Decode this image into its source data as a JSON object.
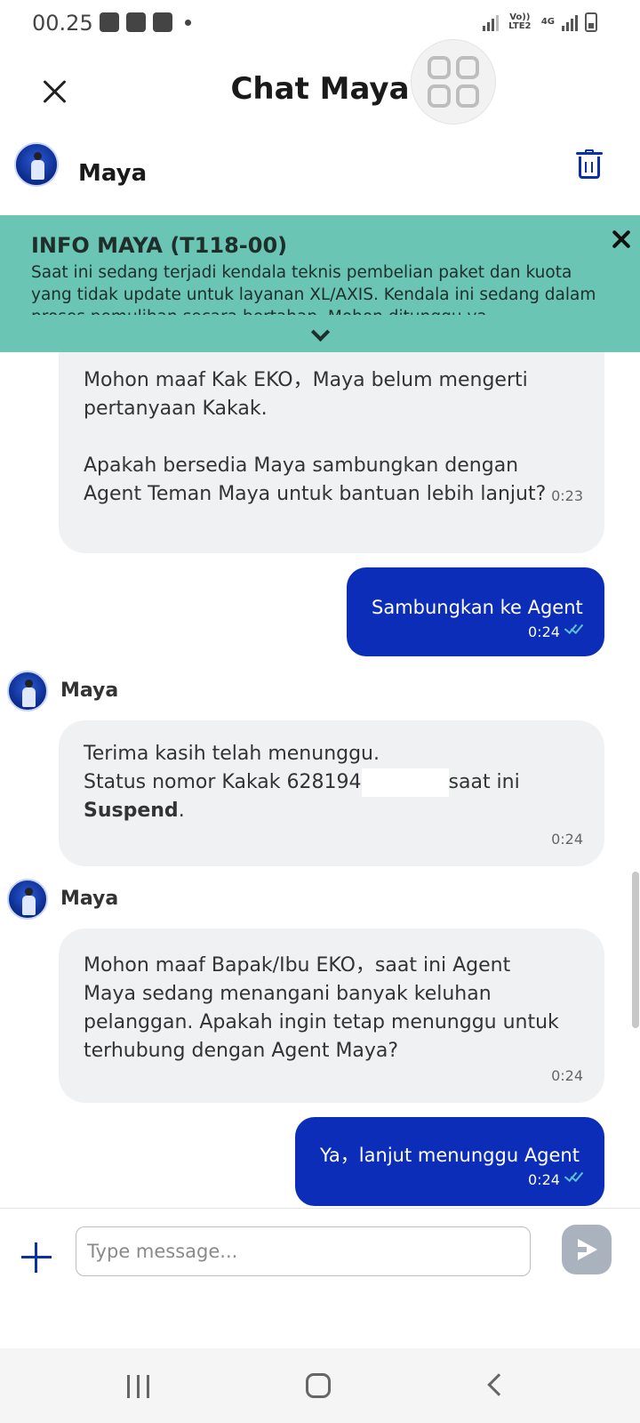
{
  "status_bar": {
    "time": "00.25",
    "network_labels": [
      "Vo)) LTE2",
      "4G"
    ]
  },
  "header": {
    "title": "Chat Maya"
  },
  "contact": {
    "name": "Maya"
  },
  "info_banner": {
    "title": "INFO MAYA (T118-00)",
    "text": "Saat ini sedang terjadi kendala teknis pembelian paket dan kuota yang tidak update untuk layanan XL/AXIS. Kendala ini sedang dalam proses pemulihan secara bertahap. Mohon ditunggu ya"
  },
  "messages": [
    {
      "from": "bot",
      "text": "Mohon maaf Kak EKO，Maya belum mengerti pertanyaan Kakak.\n\nApakah bersedia Maya sambungkan dengan Agent Teman Maya untuk bantuan lebih lanjut?",
      "time": "0:23"
    },
    {
      "from": "user",
      "text": "Sambungkan ke Agent",
      "time": "0:24"
    },
    {
      "from": "bot",
      "sender": "Maya",
      "line1": "Terima kasih telah menunggu.",
      "line2_prefix": "Status nomor Kakak 628194",
      "line2_suffix": "saat ini",
      "bold": "Suspend",
      "after_bold": ".",
      "time": "0:24"
    },
    {
      "from": "bot",
      "sender": "Maya",
      "text": "Mohon maaf Bapak/Ibu EKO，saat ini Agent Maya sedang menangani banyak keluhan pelanggan. Apakah ingin tetap menunggu untuk terhubung dengan Agent Maya?",
      "time": "0:24"
    },
    {
      "from": "user",
      "text": "Ya，lanjut menunggu Agent",
      "time": "0:24"
    }
  ],
  "composer": {
    "placeholder": "Type message..."
  },
  "colors": {
    "banner": "#6ac5b4",
    "user_bubble": "#0b2db8",
    "bot_bubble": "#eff1f3",
    "accent": "#0b2fa8"
  }
}
